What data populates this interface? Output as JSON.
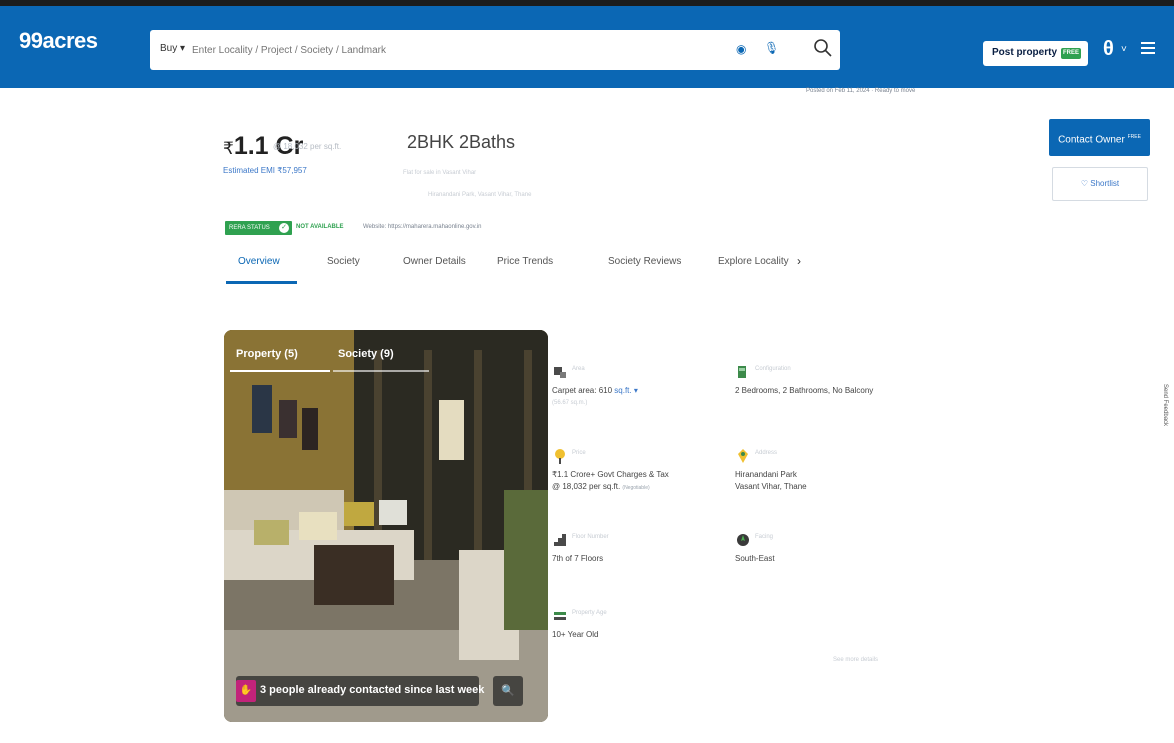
{
  "header": {
    "brand": "99acres",
    "search": {
      "buy_label": "Buy ▾",
      "placeholder": "Enter Locality / Project / Society / Landmark"
    },
    "post_property": {
      "label": "Post property",
      "badge": "FREE"
    }
  },
  "posted_info": "Posted on Feb 11, 2024 · Ready to move",
  "listing": {
    "price_symbol": "₹",
    "price": "1.1 Cr",
    "price_sub": "@ 18,032 per sq.ft.",
    "emi": "Estimated EMI ₹57,957",
    "config": "2BHK 2Baths",
    "config_sub1": "Flat for sale in Vasant Vihar",
    "config_sub2": "Hiranandani Park, Vasant Vihar, Thane"
  },
  "actions": {
    "contact": "Contact Owner",
    "contact_sup": "FREE",
    "shortlist": "♡ Shortlist"
  },
  "rera": {
    "label": "RERA STATUS",
    "status": "NOT AVAILABLE",
    "website": "Website: https://maharera.mahaonline.gov.in"
  },
  "tabs": [
    {
      "label": "Overview"
    },
    {
      "label": "Society"
    },
    {
      "label": "Owner Details"
    },
    {
      "label": "Price Trends"
    },
    {
      "label": "Society Reviews"
    },
    {
      "label": "Explore Locality"
    }
  ],
  "gallery": {
    "tabs": [
      {
        "label": "Property (5)"
      },
      {
        "label": "Society (9)"
      }
    ],
    "contacted_text": "3 people already contacted since last week"
  },
  "details": {
    "area": {
      "label": "Area",
      "value_prefix": "Carpet area: 610",
      "unit_link": "sq.ft. ▾",
      "sub": "(56.67 sq.m.)"
    },
    "configuration": {
      "label": "Configuration",
      "value": "2 Bedrooms, 2 Bathrooms, No Balcony"
    },
    "price": {
      "label": "Price",
      "line1": "₹1.1 Crore+ Govt Charges & Tax",
      "line2": "@ 18,032 per sq.ft.",
      "negotiable": "(Negotiable)"
    },
    "address": {
      "label": "Address",
      "line1": "Hiranandani Park",
      "line2": "Vasant Vihar, Thane"
    },
    "floor": {
      "label": "Floor Number",
      "value": "7th of 7 Floors"
    },
    "facing": {
      "label": "Facing",
      "value": "South-East"
    },
    "age": {
      "label": "Property Age",
      "value": "10+ Year Old"
    }
  },
  "more_link": "See more details",
  "side_label": "Send Feedback"
}
